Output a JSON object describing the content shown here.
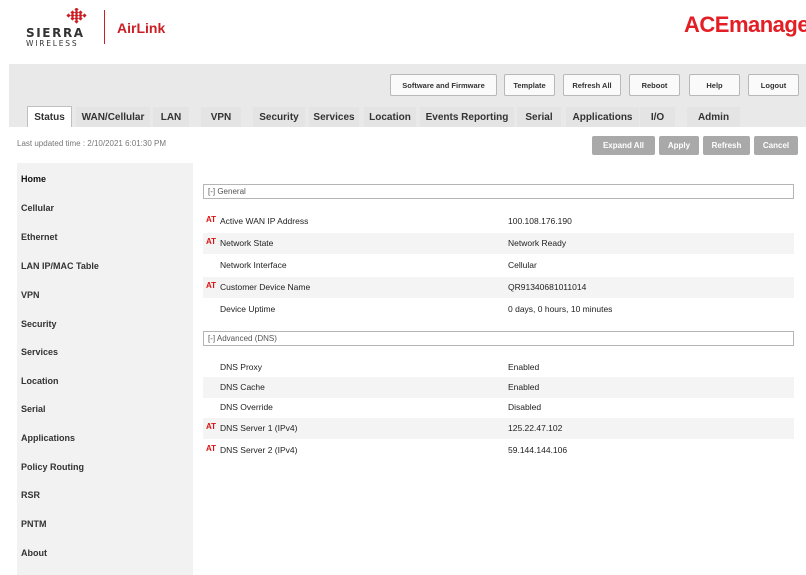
{
  "brand": {
    "company_line1": "SIERRA",
    "company_line2": "WIRELESS",
    "product": "AirLink",
    "app_title": "ACEmanager"
  },
  "toolbar": {
    "software_firmware": "Software and Firmware",
    "template": "Template",
    "refresh_all": "Refresh All",
    "reboot": "Reboot",
    "help": "Help",
    "logout": "Logout"
  },
  "tabs": [
    "Status",
    "WAN/Cellular",
    "LAN",
    "VPN",
    "Security",
    "Services",
    "Location",
    "Events Reporting",
    "Serial",
    "Applications",
    "I/O",
    "Admin"
  ],
  "active_tab": "Status",
  "last_updated": "Last updated time : 2/10/2021 6:01:30 PM",
  "actions": {
    "expand_all": "Expand All",
    "apply": "Apply",
    "refresh": "Refresh",
    "cancel": "Cancel"
  },
  "sidebar": {
    "items": [
      "Home",
      "Cellular",
      "Ethernet",
      "LAN IP/MAC Table",
      "VPN",
      "Security",
      "Services",
      "Location",
      "Serial",
      "Applications",
      "Policy Routing",
      "RSR",
      "PNTM",
      "About"
    ],
    "active": "Home"
  },
  "sections": {
    "general": {
      "title": "[-] General",
      "rows": [
        {
          "at": "AT",
          "label": "Active WAN IP Address",
          "value": "100.108.176.190"
        },
        {
          "at": "AT",
          "label": "Network State",
          "value": "Network Ready"
        },
        {
          "at": "",
          "label": "Network Interface",
          "value": "Cellular"
        },
        {
          "at": "AT",
          "label": "Customer Device Name",
          "value": "QR91340681011014"
        },
        {
          "at": "",
          "label": "Device Uptime",
          "value": "0 days, 0 hours, 10 minutes"
        }
      ]
    },
    "advanced": {
      "title": "[-] Advanced (DNS)",
      "rows": [
        {
          "at": "",
          "label": "DNS Proxy",
          "value": "Enabled"
        },
        {
          "at": "",
          "label": "DNS Cache",
          "value": "Enabled"
        },
        {
          "at": "",
          "label": "DNS Override",
          "value": "Disabled"
        },
        {
          "at": "AT",
          "label": "DNS Server 1 (IPv4)",
          "value": "125.22.47.102"
        },
        {
          "at": "AT",
          "label": "DNS Server 2 (IPv4)",
          "value": "59.144.144.106"
        }
      ]
    }
  },
  "colors": {
    "brand_red": "#e31e24",
    "at_marker": "#d11111",
    "action_button": "#a9a9a9",
    "chrome": "#e9e9e9"
  }
}
